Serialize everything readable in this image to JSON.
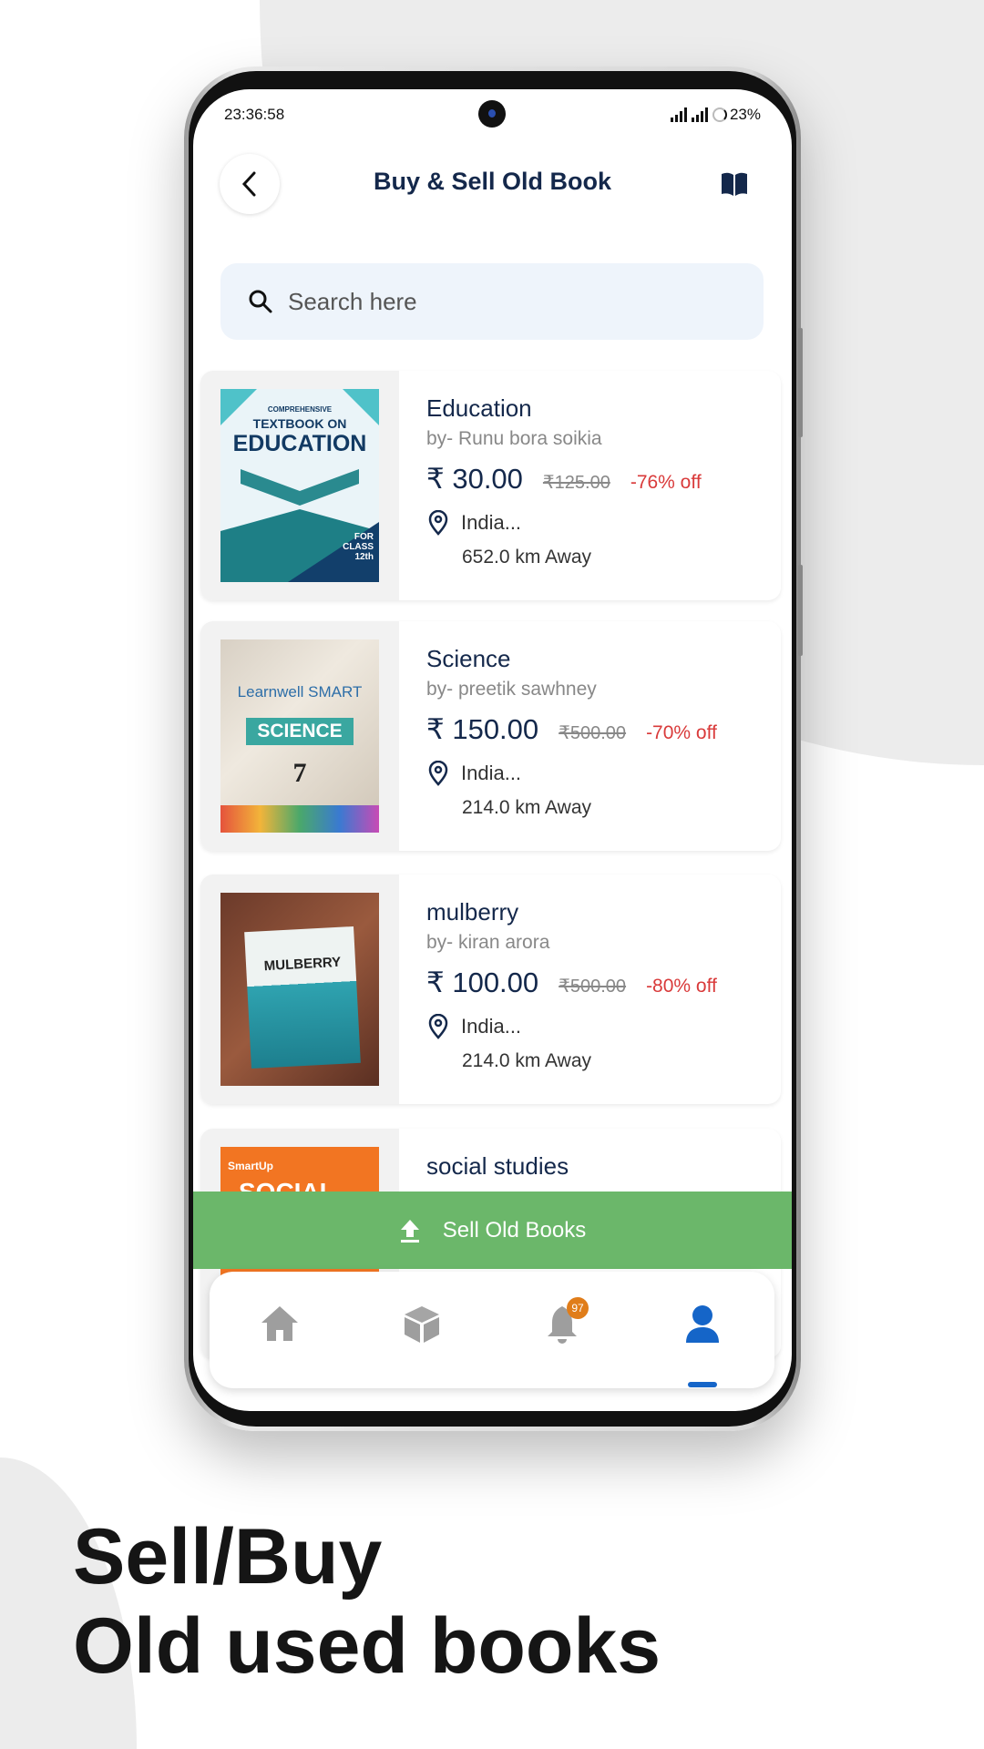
{
  "status_bar": {
    "time": "23:36:58",
    "battery": "23%"
  },
  "header": {
    "title": "Buy & Sell Old Book",
    "back_icon": "chevron-left-icon",
    "right_icon": "book-icon"
  },
  "search": {
    "placeholder": "Search here"
  },
  "books": [
    {
      "title": "Education",
      "author": "by-  Runu bora soikia",
      "price": "₹ 30.00",
      "original_price": "₹125.00",
      "discount": "-76% off",
      "location": "India...",
      "distance": "652.0 km Away",
      "cover_text": [
        "COMPREHENSIVE",
        "TEXTBOOK ON",
        "EDUCATION",
        "FOR CLASS 12th"
      ]
    },
    {
      "title": "Science",
      "author": "by-  preetik sawhney",
      "price": "₹ 150.00",
      "original_price": "₹500.00",
      "discount": "-70% off",
      "location": "India...",
      "distance": "214.0 km Away",
      "cover_text": [
        "Learnwell SMART",
        "SCIENCE",
        "7"
      ]
    },
    {
      "title": "mulberry",
      "author": "by-  kiran arora",
      "price": "₹ 100.00",
      "original_price": "₹500.00",
      "discount": "-80% off",
      "location": "India...",
      "distance": "214.0 km Away",
      "cover_text": [
        "MULBERRY"
      ]
    },
    {
      "title": "social studies",
      "cover_text": [
        "SmartUp",
        "SOCIAL"
      ]
    }
  ],
  "sell_button": {
    "label": "Sell Old Books"
  },
  "bottom_nav": {
    "items": [
      "home",
      "products",
      "notifications",
      "profile"
    ],
    "notification_badge": "97",
    "active": "profile"
  },
  "colors": {
    "primary": "#14284b",
    "accent_blue": "#1565c8",
    "green": "#6bb76a",
    "discount_red": "#d93a3a",
    "badge_orange": "#e07d1a"
  },
  "headline": {
    "line1": "Sell/Buy",
    "line2": "Old used books"
  }
}
